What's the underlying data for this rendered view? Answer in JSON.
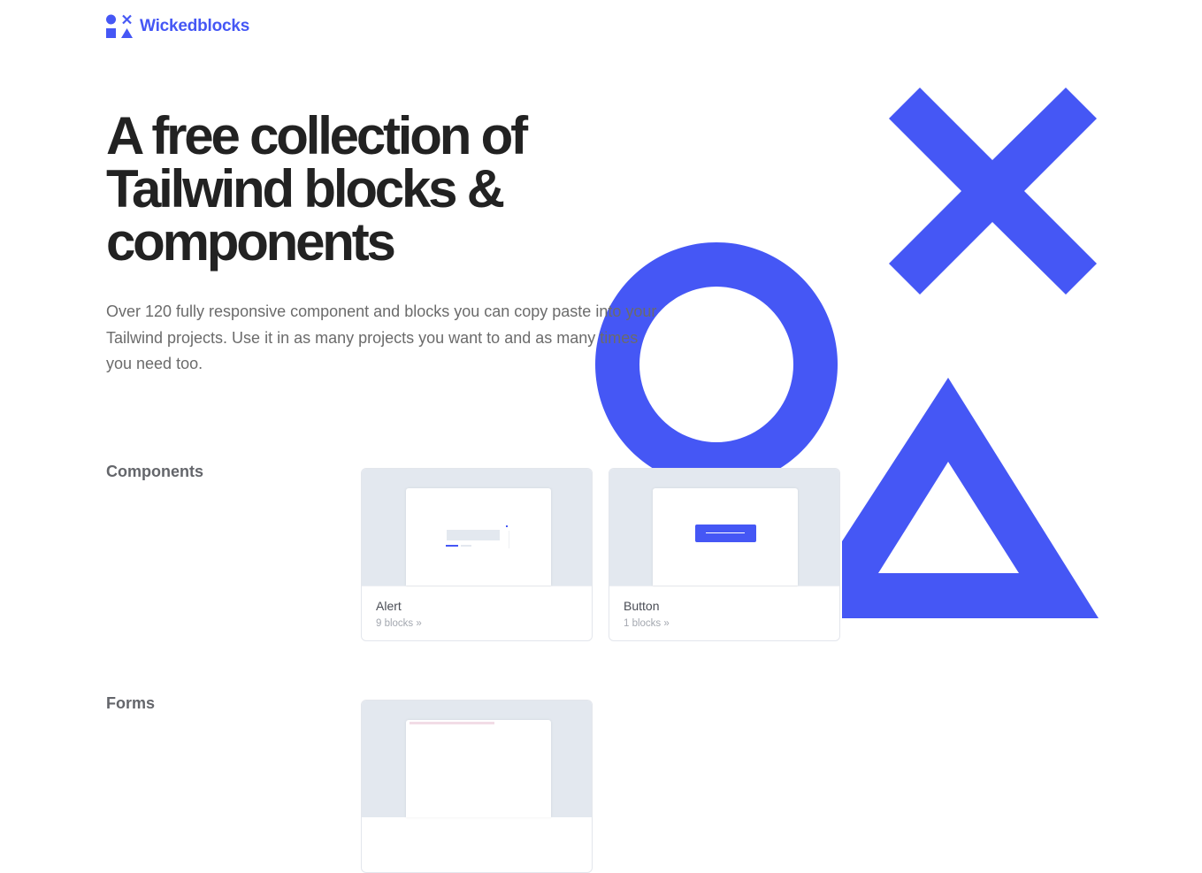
{
  "brand": {
    "name": "Wickedblocks",
    "accent": "#4557f5"
  },
  "hero": {
    "title_lines": [
      "A free collection of",
      "Tailwind blocks &",
      "components"
    ],
    "description_lines": [
      "Over 120 fully responsive component and blocks you can copy paste into your",
      "Tailwind projects. Use it in as many projects you want to and as many times",
      "you need too."
    ]
  },
  "decoration": {
    "shapes": [
      "x-shape",
      "circle-shape",
      "triangle-shape"
    ],
    "color": "#4557f5"
  },
  "sections": [
    {
      "label": "Components",
      "cards": [
        {
          "title": "Alert",
          "subtitle": "9 blocks »"
        },
        {
          "title": "Button",
          "subtitle": "1 blocks »"
        }
      ]
    },
    {
      "label": "Forms",
      "cards": []
    }
  ]
}
